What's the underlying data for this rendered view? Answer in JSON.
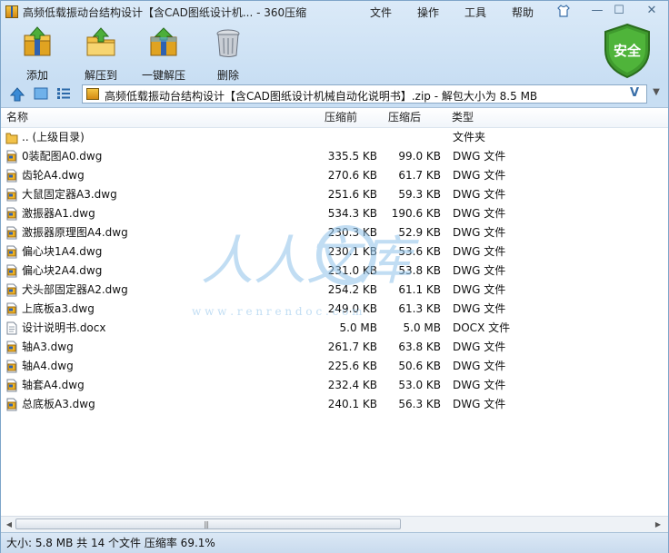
{
  "window": {
    "title": "高频低载振动台结构设计【含CAD图纸设计机... - 360压缩",
    "menu": [
      "文件",
      "操作",
      "工具",
      "帮助"
    ],
    "controls": {
      "minimize": "—",
      "maximize": "☐",
      "close": "✕"
    }
  },
  "toolbar": {
    "add_label": "添加",
    "extract_label": "解压到",
    "oneclick_label": "一键解压",
    "delete_label": "删除",
    "security_label": "安全"
  },
  "address": {
    "path": "高频低载振动台结构设计【含CAD图纸设计机械自动化说明书】.zip - 解包大小为 8.5 MB",
    "v_label": "V"
  },
  "columns": {
    "name": "名称",
    "packed": "压缩前",
    "compressed": "压缩后",
    "type": "类型"
  },
  "rows": [
    {
      "name": ".. (上级目录)",
      "packed": "",
      "compressed": "",
      "type": "文件夹",
      "icon": "folder-icon"
    },
    {
      "name": "0装配图A0.dwg",
      "packed": "335.5 KB",
      "compressed": "99.0 KB",
      "type": "DWG 文件",
      "icon": "dwg-file-icon"
    },
    {
      "name": "齿轮A4.dwg",
      "packed": "270.6 KB",
      "compressed": "61.7 KB",
      "type": "DWG 文件",
      "icon": "dwg-file-icon"
    },
    {
      "name": "大鼠固定器A3.dwg",
      "packed": "251.6 KB",
      "compressed": "59.3 KB",
      "type": "DWG 文件",
      "icon": "dwg-file-icon"
    },
    {
      "name": "激振器A1.dwg",
      "packed": "534.3 KB",
      "compressed": "190.6 KB",
      "type": "DWG 文件",
      "icon": "dwg-file-icon"
    },
    {
      "name": "激振器原理图A4.dwg",
      "packed": "230.3 KB",
      "compressed": "52.9 KB",
      "type": "DWG 文件",
      "icon": "dwg-file-icon"
    },
    {
      "name": "偏心块1A4.dwg",
      "packed": "230.1 KB",
      "compressed": "53.6 KB",
      "type": "DWG 文件",
      "icon": "dwg-file-icon"
    },
    {
      "name": "偏心块2A4.dwg",
      "packed": "231.0 KB",
      "compressed": "53.8 KB",
      "type": "DWG 文件",
      "icon": "dwg-file-icon"
    },
    {
      "name": "犬头部固定器A2.dwg",
      "packed": "254.2 KB",
      "compressed": "61.1 KB",
      "type": "DWG 文件",
      "icon": "dwg-file-icon"
    },
    {
      "name": "上底板a3.dwg",
      "packed": "249.0 KB",
      "compressed": "61.3 KB",
      "type": "DWG 文件",
      "icon": "dwg-file-icon"
    },
    {
      "name": "设计说明书.docx",
      "packed": "5.0 MB",
      "compressed": "5.0 MB",
      "type": "DOCX 文件",
      "icon": "docx-file-icon"
    },
    {
      "name": "轴A3.dwg",
      "packed": "261.7 KB",
      "compressed": "63.8 KB",
      "type": "DWG 文件",
      "icon": "dwg-file-icon"
    },
    {
      "name": "轴A4.dwg",
      "packed": "225.6 KB",
      "compressed": "50.6 KB",
      "type": "DWG 文件",
      "icon": "dwg-file-icon"
    },
    {
      "name": "轴套A4.dwg",
      "packed": "232.4 KB",
      "compressed": "53.0 KB",
      "type": "DWG 文件",
      "icon": "dwg-file-icon"
    },
    {
      "name": "总底板A3.dwg",
      "packed": "240.1 KB",
      "compressed": "56.3 KB",
      "type": "DWG 文件",
      "icon": "dwg-file-icon"
    }
  ],
  "watermark": {
    "text": "人人文库",
    "url": "w w w . r e n r e n d o c . c o m"
  },
  "status": "大小: 5.8 MB 共 14 个文件 压缩率 69.1%",
  "colors": {
    "accent": "#3a6fa8",
    "shield": "#3f9a2e",
    "window_bg": "#cfe3f5"
  }
}
